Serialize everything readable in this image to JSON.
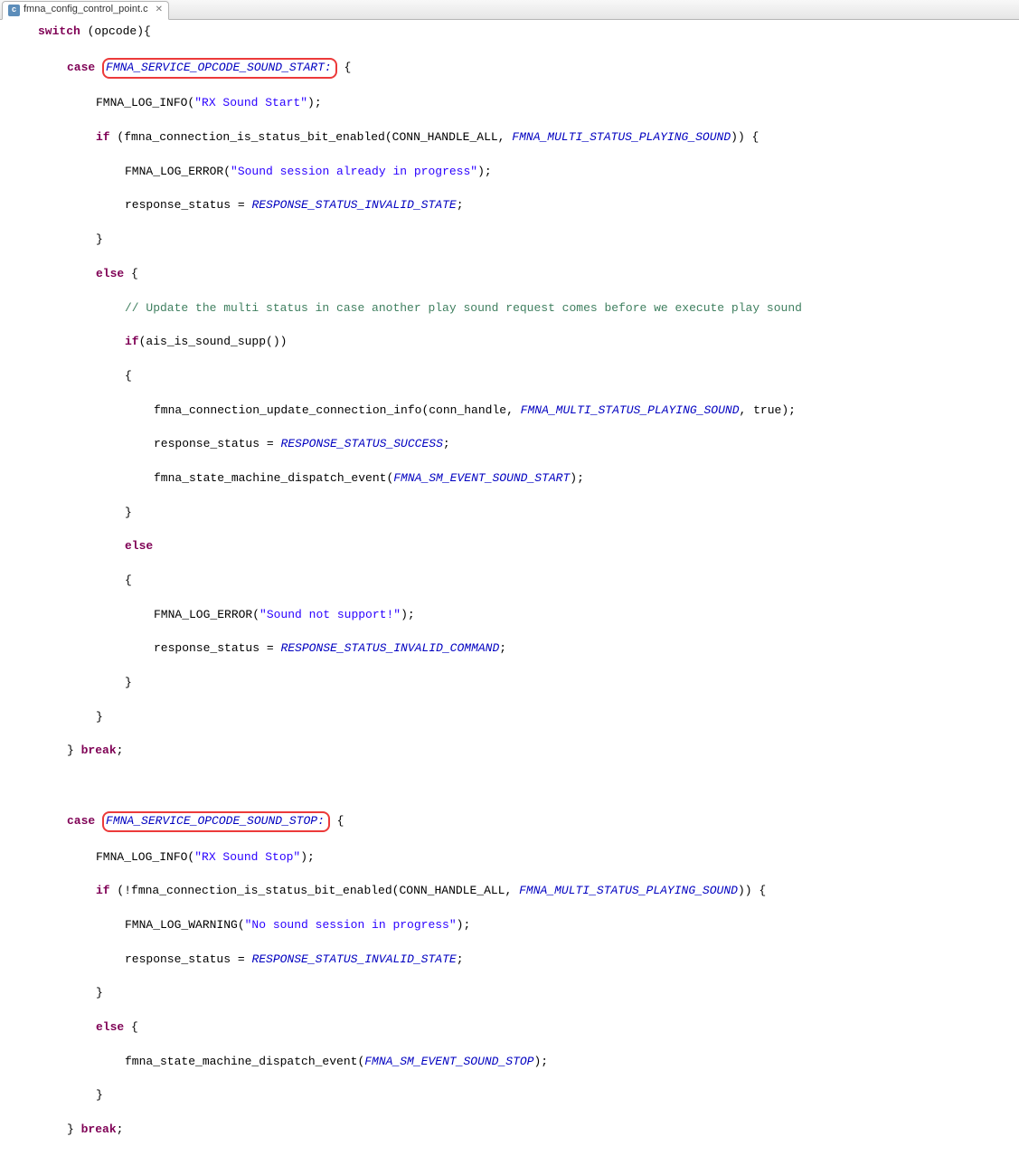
{
  "tab": {
    "filename": "fmna_config_control_point.c",
    "close_icon": "✕",
    "file_icon_letter": "c"
  },
  "code": {
    "l1": {
      "kw1": "switch",
      "txt": " (opcode){"
    },
    "l2": {
      "kw1": "case",
      "hl": "FMNA_SERVICE_OPCODE_SOUND_START:",
      "txt2": " {"
    },
    "l3": {
      "fn": "FMNA_LOG_INFO(",
      "str": "\"RX Sound Start\"",
      "close": ");"
    },
    "l4": {
      "kw": "if",
      "txt1": " (fmna_connection_is_status_bit_enabled(CONN_HANDLE_ALL, ",
      "const": "FMNA_MULTI_STATUS_PLAYING_SOUND",
      "txt2": ")) {"
    },
    "l5": {
      "fn": "FMNA_LOG_ERROR(",
      "str": "\"Sound session already in progress\"",
      "close": ");"
    },
    "l6": {
      "txt": "response_status = ",
      "const": "RESPONSE_STATUS_INVALID_STATE",
      "close": ";"
    },
    "l7": {
      "txt": "}"
    },
    "l8": {
      "kw": "else",
      "txt": " {"
    },
    "l9": {
      "comment": "// Update the multi status in case another play sound request comes before we execute play sound"
    },
    "l10": {
      "kw": "if",
      "txt": "(ais_is_sound_supp())"
    },
    "l11": {
      "txt": "{"
    },
    "l12": {
      "txt1": "fmna_connection_update_connection_info(conn_handle, ",
      "const": "FMNA_MULTI_STATUS_PLAYING_SOUND",
      "txt2": ", true);"
    },
    "l13": {
      "txt": "response_status = ",
      "const": "RESPONSE_STATUS_SUCCESS",
      "close": ";"
    },
    "l14": {
      "txt1": "fmna_state_machine_dispatch_event(",
      "const": "FMNA_SM_EVENT_SOUND_START",
      "close": ");"
    },
    "l15": {
      "txt": "}"
    },
    "l16": {
      "kw": "else"
    },
    "l17": {
      "txt": "{"
    },
    "l18": {
      "fn": "FMNA_LOG_ERROR(",
      "str": "\"Sound not support!\"",
      "close": ");"
    },
    "l19": {
      "txt": "response_status = ",
      "const": "RESPONSE_STATUS_INVALID_COMMAND",
      "close": ";"
    },
    "l20": {
      "txt": "}"
    },
    "l21": {
      "txt": "}"
    },
    "l22": {
      "txt": "} ",
      "kw": "break",
      "close": ";"
    },
    "l23": {
      "kw": "case",
      "hl": "FMNA_SERVICE_OPCODE_SOUND_STOP:",
      "txt2": " {"
    },
    "l24": {
      "fn": "FMNA_LOG_INFO(",
      "str": "\"RX Sound Stop\"",
      "close": ");"
    },
    "l25": {
      "kw": "if",
      "txt1": " (!fmna_connection_is_status_bit_enabled(CONN_HANDLE_ALL, ",
      "const": "FMNA_MULTI_STATUS_PLAYING_SOUND",
      "txt2": ")) {"
    },
    "l26": {
      "fn": "FMNA_LOG_WARNING(",
      "str": "\"No sound session in progress\"",
      "close": ");"
    },
    "l27": {
      "txt": "response_status = ",
      "const": "RESPONSE_STATUS_INVALID_STATE",
      "close": ";"
    },
    "l28": {
      "txt": "}"
    },
    "l29": {
      "kw": "else",
      "txt": " {"
    },
    "l30": {
      "txt1": "fmna_state_machine_dispatch_event(",
      "const": "FMNA_SM_EVENT_SOUND_STOP",
      "close": ");"
    },
    "l31": {
      "txt": "}"
    },
    "l32": {
      "txt": "} ",
      "kw": "break",
      "close": ";"
    }
  }
}
